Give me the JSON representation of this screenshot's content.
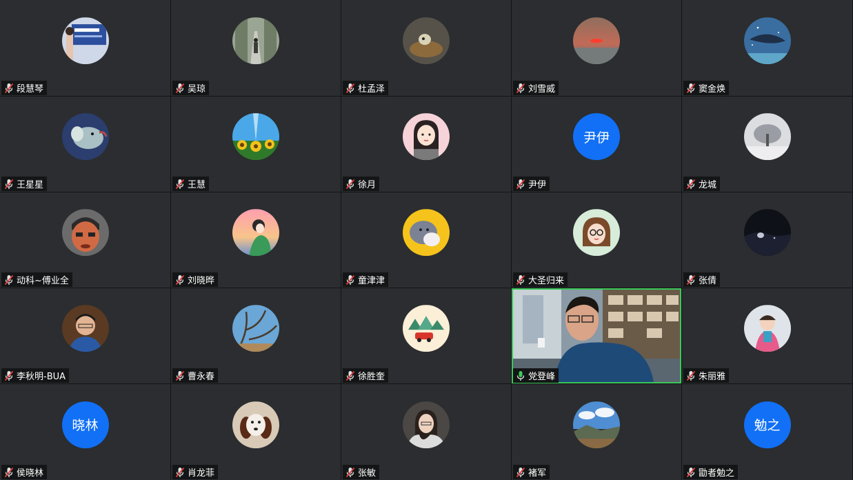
{
  "participants": [
    {
      "name": "段慧琴",
      "avatar": "photo-banner",
      "mic": "muted"
    },
    {
      "name": "吴琼",
      "avatar": "photo-tree-road",
      "mic": "muted"
    },
    {
      "name": "杜孟泽",
      "avatar": "photo-cat",
      "mic": "muted"
    },
    {
      "name": "刘雪威",
      "avatar": "photo-sunset",
      "mic": "muted"
    },
    {
      "name": "窦金焕",
      "avatar": "photo-whale",
      "mic": "muted"
    },
    {
      "name": "王星星",
      "avatar": "photo-animal",
      "mic": "muted"
    },
    {
      "name": "王慧",
      "avatar": "photo-sunflowers",
      "mic": "muted"
    },
    {
      "name": "徐月",
      "avatar": "illustration-girl",
      "mic": "muted"
    },
    {
      "name": "尹伊",
      "avatar": "initials",
      "initials": "尹伊",
      "mic": "muted"
    },
    {
      "name": "龙城",
      "avatar": "photo-snow-tree",
      "mic": "muted"
    },
    {
      "name": "动科~傅业全",
      "avatar": "painting-face",
      "mic": "muted"
    },
    {
      "name": "刘晓晔",
      "avatar": "illustration-sunset-girl",
      "mic": "muted"
    },
    {
      "name": "童津津",
      "avatar": "illustration-cats",
      "mic": "muted"
    },
    {
      "name": "大圣归来",
      "avatar": "illustration-glasses-woman",
      "mic": "muted"
    },
    {
      "name": "张倩",
      "avatar": "photo-night",
      "mic": "muted"
    },
    {
      "name": "李秋明-BUA",
      "avatar": "photo-man",
      "mic": "muted"
    },
    {
      "name": "曹永春",
      "avatar": "photo-branches",
      "mic": "muted"
    },
    {
      "name": "徐胜奎",
      "avatar": "illustration-car",
      "mic": "muted"
    },
    {
      "name": "党登峰",
      "avatar": "video",
      "mic": "active"
    },
    {
      "name": "朱丽雅",
      "avatar": "photo-child",
      "mic": "muted"
    },
    {
      "name": "侯晓林",
      "avatar": "initials",
      "initials": "晓林",
      "mic": "muted"
    },
    {
      "name": "肖龙菲",
      "avatar": "photo-dog",
      "mic": "muted"
    },
    {
      "name": "张敏",
      "avatar": "photo-woman",
      "mic": "muted"
    },
    {
      "name": "褚军",
      "avatar": "photo-landscape",
      "mic": "muted"
    },
    {
      "name": "勖者勉之",
      "avatar": "initials",
      "initials": "勉之",
      "mic": "muted"
    }
  ],
  "colors": {
    "tile_bg": "#2b2d30",
    "initials_bg": "#1170f5",
    "active_speaker": "#3cc95a",
    "muted_icon": "#e0403a"
  }
}
